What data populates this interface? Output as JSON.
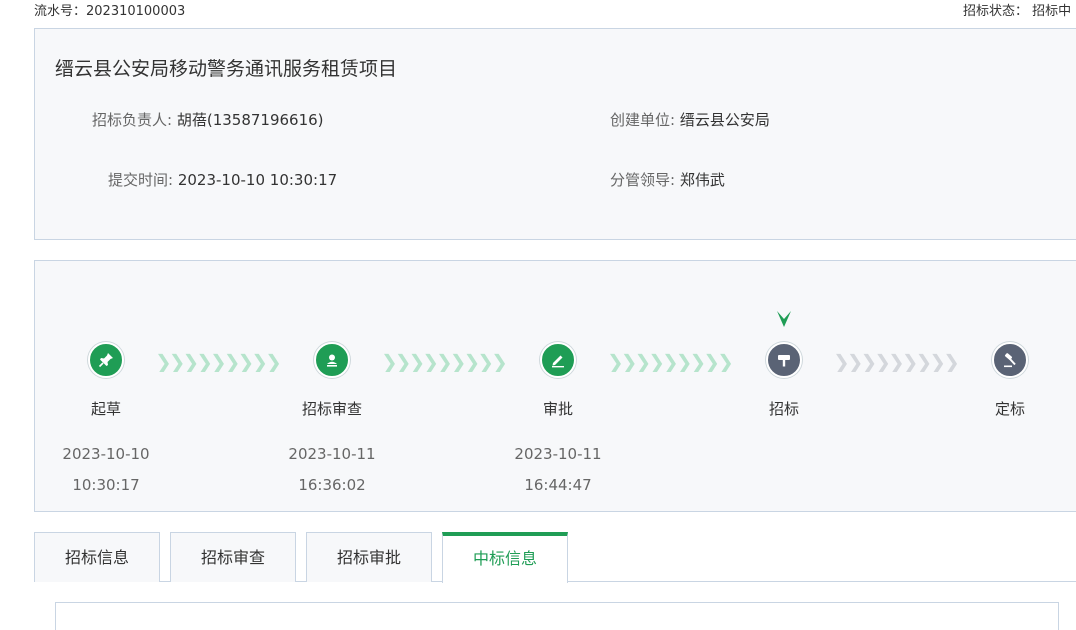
{
  "header": {
    "serial_label": "流水号：",
    "serial_value": "202310100003",
    "status_label": "招标状态：",
    "status_value": "招标中"
  },
  "project": {
    "title": "缙云县公安局移动警务通讯服务租赁项目",
    "owner_label": "招标负责人:",
    "owner_value": "胡蓓(13587196616)",
    "org_label": "创建单位:",
    "org_value": "缙云县公安局",
    "submit_label": "提交时间:",
    "submit_value": "2023-10-10 10:30:17",
    "leader_label": "分管领导:",
    "leader_value": "郑伟武"
  },
  "flow": {
    "colors": {
      "done": "#1f9d55",
      "todo": "#5a6375",
      "arrow_done": "#b6e4cc",
      "arrow_todo": "#d4d7dc"
    },
    "chevrons": "❯❯❯❯❯❯❯❯❯❯",
    "steps": [
      {
        "name": "起草",
        "icon": "pin-icon",
        "status": "done",
        "date": "2023-10-10",
        "time": "10:30:17"
      },
      {
        "name": "招标审查",
        "icon": "user-stamp-icon",
        "status": "done",
        "date": "2023-10-11",
        "time": "16:36:02"
      },
      {
        "name": "审批",
        "icon": "pencil-icon",
        "status": "done",
        "date": "2023-10-11",
        "time": "16:44:47"
      },
      {
        "name": "招标",
        "icon": "hammer-icon",
        "status": "current",
        "date": "",
        "time": ""
      },
      {
        "name": "定标",
        "icon": "gavel-icon",
        "status": "todo",
        "date": "",
        "time": ""
      }
    ]
  },
  "tabs": [
    {
      "label": "招标信息",
      "active": false
    },
    {
      "label": "招标审查",
      "active": false
    },
    {
      "label": "招标审批",
      "active": false
    },
    {
      "label": "中标信息",
      "active": true
    }
  ]
}
